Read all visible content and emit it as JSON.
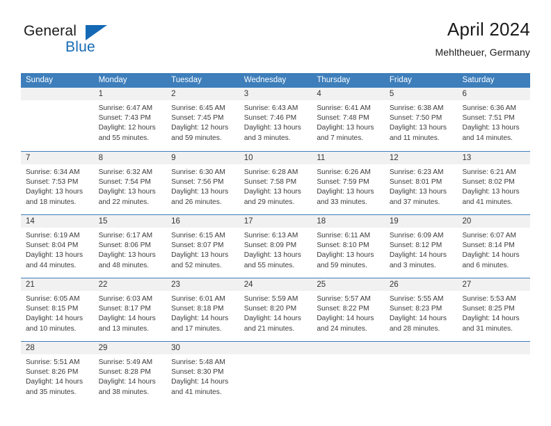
{
  "brand": {
    "line1": "General",
    "line2": "Blue",
    "accent_color": "#1569b4"
  },
  "header": {
    "title": "April 2024",
    "subtitle": "Mehltheuer, Germany"
  },
  "calendar": {
    "header_bg": "#3d7ebb",
    "day_number_bg": "#f1f1f1",
    "weekday_headers": [
      "Sunday",
      "Monday",
      "Tuesday",
      "Wednesday",
      "Thursday",
      "Friday",
      "Saturday"
    ],
    "weeks": [
      [
        {
          "day": "",
          "sunrise": "",
          "sunset": "",
          "daylight_line1": "",
          "daylight_line2": "",
          "empty": true
        },
        {
          "day": "1",
          "sunrise": "Sunrise: 6:47 AM",
          "sunset": "Sunset: 7:43 PM",
          "daylight_line1": "Daylight: 12 hours",
          "daylight_line2": "and 55 minutes."
        },
        {
          "day": "2",
          "sunrise": "Sunrise: 6:45 AM",
          "sunset": "Sunset: 7:45 PM",
          "daylight_line1": "Daylight: 12 hours",
          "daylight_line2": "and 59 minutes."
        },
        {
          "day": "3",
          "sunrise": "Sunrise: 6:43 AM",
          "sunset": "Sunset: 7:46 PM",
          "daylight_line1": "Daylight: 13 hours",
          "daylight_line2": "and 3 minutes."
        },
        {
          "day": "4",
          "sunrise": "Sunrise: 6:41 AM",
          "sunset": "Sunset: 7:48 PM",
          "daylight_line1": "Daylight: 13 hours",
          "daylight_line2": "and 7 minutes."
        },
        {
          "day": "5",
          "sunrise": "Sunrise: 6:38 AM",
          "sunset": "Sunset: 7:50 PM",
          "daylight_line1": "Daylight: 13 hours",
          "daylight_line2": "and 11 minutes."
        },
        {
          "day": "6",
          "sunrise": "Sunrise: 6:36 AM",
          "sunset": "Sunset: 7:51 PM",
          "daylight_line1": "Daylight: 13 hours",
          "daylight_line2": "and 14 minutes."
        }
      ],
      [
        {
          "day": "7",
          "sunrise": "Sunrise: 6:34 AM",
          "sunset": "Sunset: 7:53 PM",
          "daylight_line1": "Daylight: 13 hours",
          "daylight_line2": "and 18 minutes."
        },
        {
          "day": "8",
          "sunrise": "Sunrise: 6:32 AM",
          "sunset": "Sunset: 7:54 PM",
          "daylight_line1": "Daylight: 13 hours",
          "daylight_line2": "and 22 minutes."
        },
        {
          "day": "9",
          "sunrise": "Sunrise: 6:30 AM",
          "sunset": "Sunset: 7:56 PM",
          "daylight_line1": "Daylight: 13 hours",
          "daylight_line2": "and 26 minutes."
        },
        {
          "day": "10",
          "sunrise": "Sunrise: 6:28 AM",
          "sunset": "Sunset: 7:58 PM",
          "daylight_line1": "Daylight: 13 hours",
          "daylight_line2": "and 29 minutes."
        },
        {
          "day": "11",
          "sunrise": "Sunrise: 6:26 AM",
          "sunset": "Sunset: 7:59 PM",
          "daylight_line1": "Daylight: 13 hours",
          "daylight_line2": "and 33 minutes."
        },
        {
          "day": "12",
          "sunrise": "Sunrise: 6:23 AM",
          "sunset": "Sunset: 8:01 PM",
          "daylight_line1": "Daylight: 13 hours",
          "daylight_line2": "and 37 minutes."
        },
        {
          "day": "13",
          "sunrise": "Sunrise: 6:21 AM",
          "sunset": "Sunset: 8:02 PM",
          "daylight_line1": "Daylight: 13 hours",
          "daylight_line2": "and 41 minutes."
        }
      ],
      [
        {
          "day": "14",
          "sunrise": "Sunrise: 6:19 AM",
          "sunset": "Sunset: 8:04 PM",
          "daylight_line1": "Daylight: 13 hours",
          "daylight_line2": "and 44 minutes."
        },
        {
          "day": "15",
          "sunrise": "Sunrise: 6:17 AM",
          "sunset": "Sunset: 8:06 PM",
          "daylight_line1": "Daylight: 13 hours",
          "daylight_line2": "and 48 minutes."
        },
        {
          "day": "16",
          "sunrise": "Sunrise: 6:15 AM",
          "sunset": "Sunset: 8:07 PM",
          "daylight_line1": "Daylight: 13 hours",
          "daylight_line2": "and 52 minutes."
        },
        {
          "day": "17",
          "sunrise": "Sunrise: 6:13 AM",
          "sunset": "Sunset: 8:09 PM",
          "daylight_line1": "Daylight: 13 hours",
          "daylight_line2": "and 55 minutes."
        },
        {
          "day": "18",
          "sunrise": "Sunrise: 6:11 AM",
          "sunset": "Sunset: 8:10 PM",
          "daylight_line1": "Daylight: 13 hours",
          "daylight_line2": "and 59 minutes."
        },
        {
          "day": "19",
          "sunrise": "Sunrise: 6:09 AM",
          "sunset": "Sunset: 8:12 PM",
          "daylight_line1": "Daylight: 14 hours",
          "daylight_line2": "and 3 minutes."
        },
        {
          "day": "20",
          "sunrise": "Sunrise: 6:07 AM",
          "sunset": "Sunset: 8:14 PM",
          "daylight_line1": "Daylight: 14 hours",
          "daylight_line2": "and 6 minutes."
        }
      ],
      [
        {
          "day": "21",
          "sunrise": "Sunrise: 6:05 AM",
          "sunset": "Sunset: 8:15 PM",
          "daylight_line1": "Daylight: 14 hours",
          "daylight_line2": "and 10 minutes."
        },
        {
          "day": "22",
          "sunrise": "Sunrise: 6:03 AM",
          "sunset": "Sunset: 8:17 PM",
          "daylight_line1": "Daylight: 14 hours",
          "daylight_line2": "and 13 minutes."
        },
        {
          "day": "23",
          "sunrise": "Sunrise: 6:01 AM",
          "sunset": "Sunset: 8:18 PM",
          "daylight_line1": "Daylight: 14 hours",
          "daylight_line2": "and 17 minutes."
        },
        {
          "day": "24",
          "sunrise": "Sunrise: 5:59 AM",
          "sunset": "Sunset: 8:20 PM",
          "daylight_line1": "Daylight: 14 hours",
          "daylight_line2": "and 21 minutes."
        },
        {
          "day": "25",
          "sunrise": "Sunrise: 5:57 AM",
          "sunset": "Sunset: 8:22 PM",
          "daylight_line1": "Daylight: 14 hours",
          "daylight_line2": "and 24 minutes."
        },
        {
          "day": "26",
          "sunrise": "Sunrise: 5:55 AM",
          "sunset": "Sunset: 8:23 PM",
          "daylight_line1": "Daylight: 14 hours",
          "daylight_line2": "and 28 minutes."
        },
        {
          "day": "27",
          "sunrise": "Sunrise: 5:53 AM",
          "sunset": "Sunset: 8:25 PM",
          "daylight_line1": "Daylight: 14 hours",
          "daylight_line2": "and 31 minutes."
        }
      ],
      [
        {
          "day": "28",
          "sunrise": "Sunrise: 5:51 AM",
          "sunset": "Sunset: 8:26 PM",
          "daylight_line1": "Daylight: 14 hours",
          "daylight_line2": "and 35 minutes."
        },
        {
          "day": "29",
          "sunrise": "Sunrise: 5:49 AM",
          "sunset": "Sunset: 8:28 PM",
          "daylight_line1": "Daylight: 14 hours",
          "daylight_line2": "and 38 minutes."
        },
        {
          "day": "30",
          "sunrise": "Sunrise: 5:48 AM",
          "sunset": "Sunset: 8:30 PM",
          "daylight_line1": "Daylight: 14 hours",
          "daylight_line2": "and 41 minutes."
        },
        {
          "day": "",
          "sunrise": "",
          "sunset": "",
          "daylight_line1": "",
          "daylight_line2": "",
          "empty": true
        },
        {
          "day": "",
          "sunrise": "",
          "sunset": "",
          "daylight_line1": "",
          "daylight_line2": "",
          "empty": true
        },
        {
          "day": "",
          "sunrise": "",
          "sunset": "",
          "daylight_line1": "",
          "daylight_line2": "",
          "empty": true
        },
        {
          "day": "",
          "sunrise": "",
          "sunset": "",
          "daylight_line1": "",
          "daylight_line2": "",
          "empty": true
        }
      ]
    ]
  }
}
